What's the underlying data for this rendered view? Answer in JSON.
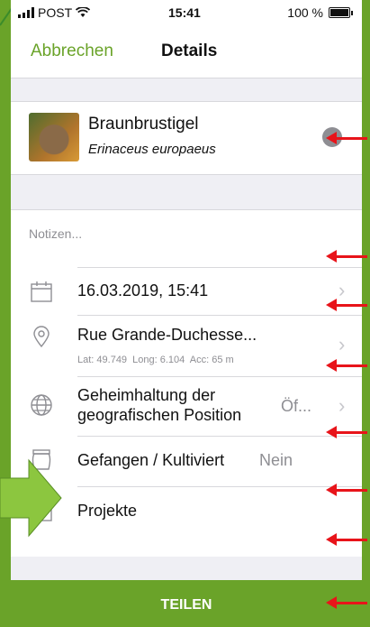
{
  "status": {
    "carrier": "POST",
    "time": "15:41",
    "battery": "100 %"
  },
  "nav": {
    "cancel": "Abbrechen",
    "title": "Details"
  },
  "species": {
    "name": "Braunbrustigel",
    "latin": "Erinaceus europaeus",
    "check_icon": "checkmark-icon"
  },
  "notes": {
    "placeholder": "Notizen..."
  },
  "rows": {
    "date": {
      "label": "16.03.2019, 15:41",
      "icon": "calendar-icon"
    },
    "location": {
      "label": "Rue Grande-Duchesse...",
      "detail": "Lat: 49.749  Long: 6.104  Acc: 65 m",
      "icon": "location-pin-icon"
    },
    "privacy": {
      "label_line1": "Geheimhaltung der",
      "label_line2": "geografischen Position",
      "value": "Öf...",
      "icon": "globe-icon"
    },
    "captive": {
      "label": "Gefangen / Kultiviert",
      "value": "Nein",
      "icon": "jar-icon"
    },
    "projects": {
      "label": "Projekte",
      "icon": "briefcase-icon"
    }
  },
  "share_label": "TEILEN",
  "colors": {
    "accent": "#6aa329",
    "annotation": "#e8141a"
  }
}
